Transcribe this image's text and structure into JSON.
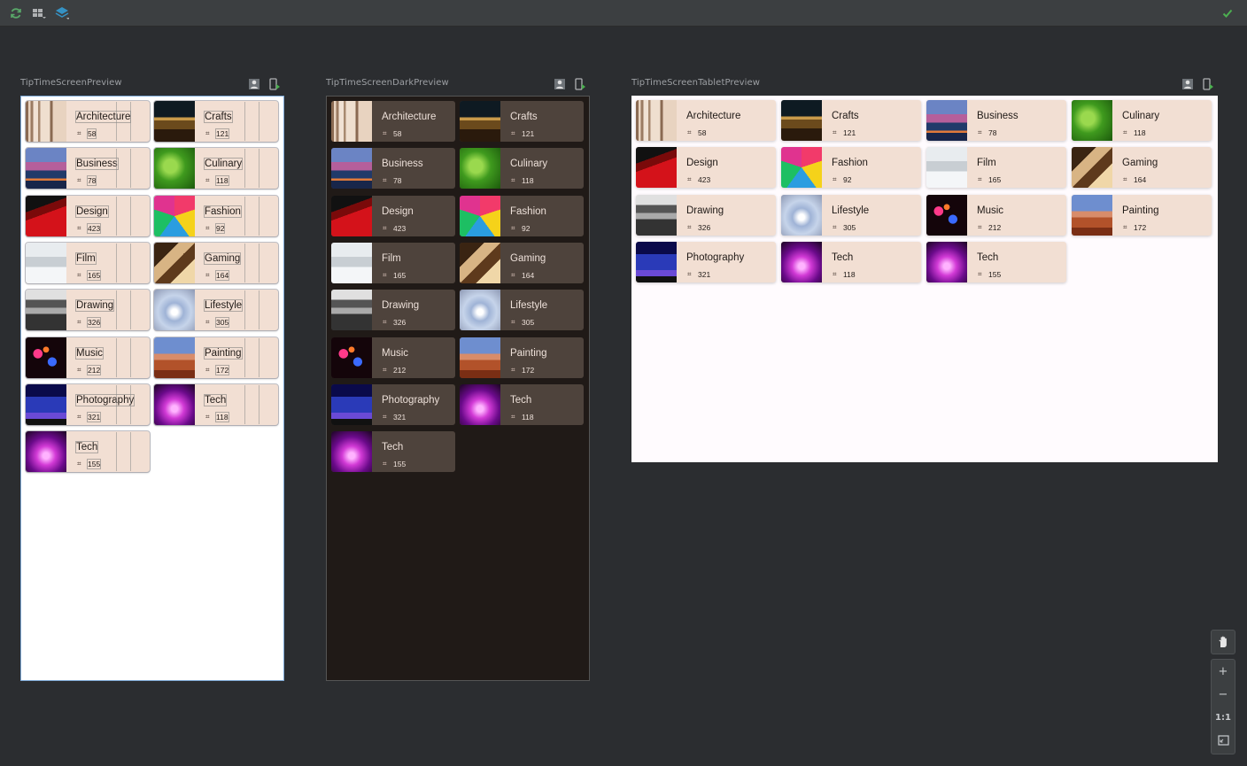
{
  "toolbar": {
    "refresh_icon": "refresh-icon",
    "layout_icon": "layout-grid-icon",
    "layers_icon": "layers-icon",
    "status_icon": "check-icon"
  },
  "previews": {
    "light_title": "TipTimeScreenPreview",
    "dark_title": "TipTimeScreenDarkPreview",
    "tablet_title": "TipTimeScreenTabletPreview"
  },
  "topics": [
    {
      "name": "Architecture",
      "count": "58"
    },
    {
      "name": "Crafts",
      "count": "121"
    },
    {
      "name": "Business",
      "count": "78"
    },
    {
      "name": "Culinary",
      "count": "118"
    },
    {
      "name": "Design",
      "count": "423"
    },
    {
      "name": "Fashion",
      "count": "92"
    },
    {
      "name": "Film",
      "count": "165"
    },
    {
      "name": "Gaming",
      "count": "164"
    },
    {
      "name": "Drawing",
      "count": "326"
    },
    {
      "name": "Lifestyle",
      "count": "305"
    },
    {
      "name": "Music",
      "count": "212"
    },
    {
      "name": "Painting",
      "count": "172"
    },
    {
      "name": "Photography",
      "count": "321"
    },
    {
      "name": "Tech",
      "count": "118"
    },
    {
      "name": "Tech",
      "count": "155"
    }
  ],
  "zoom": {
    "pan_icon": "hand-icon",
    "zoom_in": "+",
    "zoom_out": "−",
    "actual_size": "1:1",
    "fit_icon": "fit-screen-icon"
  },
  "colors": {
    "card_light": "#f2dfd3",
    "card_dark": "#4e433c",
    "accent_green": "#4caf50"
  }
}
